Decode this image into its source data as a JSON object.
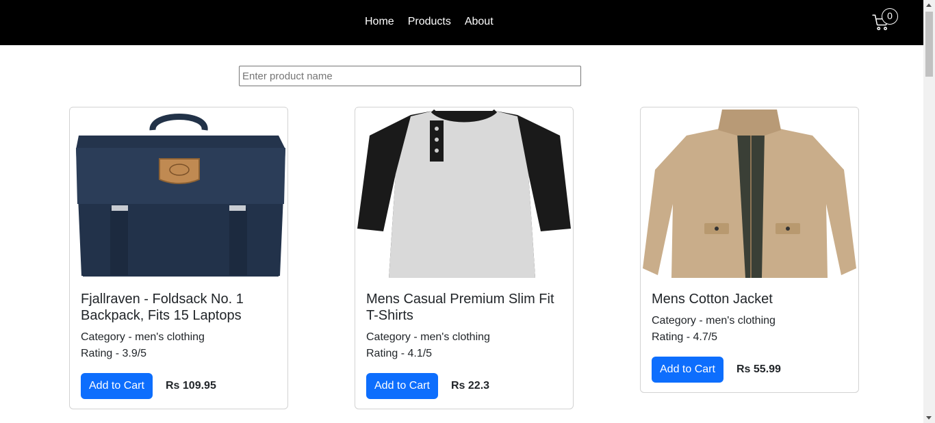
{
  "nav": {
    "links": [
      "Home",
      "Products",
      "About"
    ],
    "cart_count": "0"
  },
  "search": {
    "placeholder": "Enter product name",
    "value": ""
  },
  "products": [
    {
      "title": "Fjallraven - Foldsack No. 1 Backpack, Fits 15 Laptops",
      "category": "Category - men's clothing",
      "rating": "Rating - 3.9/5",
      "button_label": "Add to Cart",
      "price": "Rs 109.95",
      "image_icon": "backpack-image"
    },
    {
      "title": "Mens Casual Premium Slim Fit T-Shirts",
      "category": "Category - men's clothing",
      "rating": "Rating - 4.1/5",
      "button_label": "Add to Cart",
      "price": "Rs 22.3",
      "image_icon": "tshirt-image"
    },
    {
      "title": "Mens Cotton Jacket",
      "category": "Category - men's clothing",
      "rating": "Rating - 4.7/5",
      "button_label": "Add to Cart",
      "price": "Rs 55.99",
      "image_icon": "jacket-image"
    }
  ],
  "colors": {
    "navbar": "#000000",
    "button": "#0d6efd"
  }
}
